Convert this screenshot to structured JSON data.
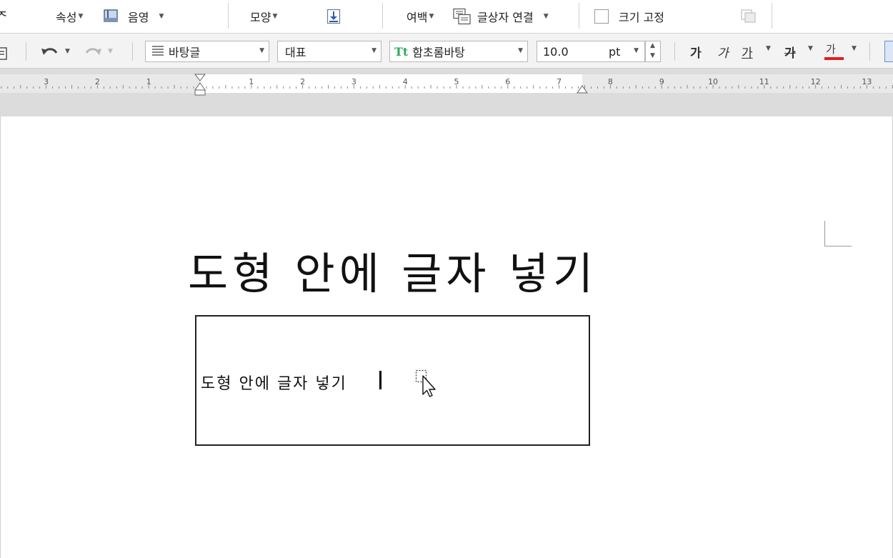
{
  "ribbon": {
    "properties_label": "속성",
    "shadow_label": "음영",
    "shape_label": "모양",
    "margin_label": "여백",
    "textbox_link_label": "글상자 연결",
    "fix_size_label": "크기 고정",
    "fix_size_checked": false
  },
  "toolbar": {
    "style_value": "바탕글",
    "lang_value": "대표",
    "font_value": "함초롬바탕",
    "size_value": "10.0",
    "unit_value": "pt",
    "bold_label": "가",
    "italic_label": "가",
    "underline_label": "가",
    "strike_label": "가",
    "color_label": "가",
    "font_color": "#e0201c"
  },
  "ruler": {
    "numbers_left": [
      "3",
      "2",
      "1"
    ],
    "numbers_right": [
      "1",
      "2",
      "3",
      "4",
      "5",
      "6",
      "7",
      "8",
      "9",
      "10",
      "11",
      "12",
      "13"
    ]
  },
  "document": {
    "title": "도형 안에 글자 넣기",
    "shape_text": "도형 안에 글자 넣기"
  }
}
